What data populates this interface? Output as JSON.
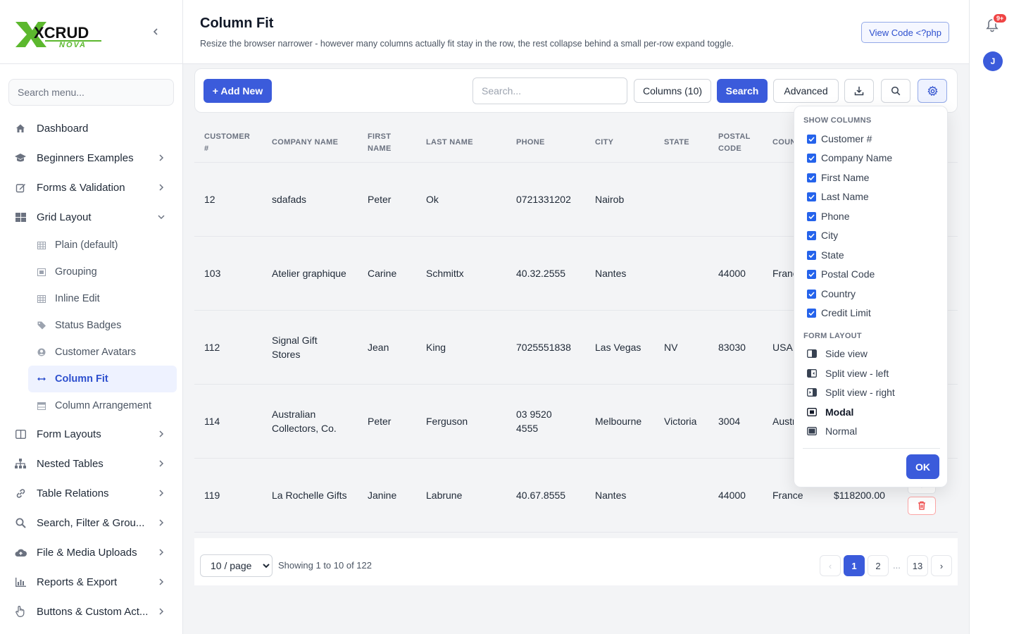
{
  "brand": {
    "logo_main": "XCRUD",
    "logo_sub": "NOVA"
  },
  "sidebar": {
    "search_placeholder": "Search menu...",
    "items": [
      {
        "label": "Dashboard"
      },
      {
        "label": "Beginners Examples"
      },
      {
        "label": "Forms & Validation"
      },
      {
        "label": "Grid Layout"
      },
      {
        "label": "Form Layouts"
      },
      {
        "label": "Nested Tables"
      },
      {
        "label": "Table Relations"
      },
      {
        "label": "Search, Filter & Grou..."
      },
      {
        "label": "File & Media Uploads"
      },
      {
        "label": "Reports & Export"
      },
      {
        "label": "Buttons & Custom Act..."
      }
    ],
    "sub_items": [
      {
        "label": "Plain (default)"
      },
      {
        "label": "Grouping"
      },
      {
        "label": "Inline Edit"
      },
      {
        "label": "Status Badges"
      },
      {
        "label": "Customer Avatars"
      },
      {
        "label": "Column Fit"
      },
      {
        "label": "Column Arrangement"
      }
    ]
  },
  "header": {
    "title": "Column Fit",
    "subtitle": "Resize the browser narrower - however many columns actually fit stay in the row, the rest collapse behind a small per-row expand toggle.",
    "view_code": "View Code <?php"
  },
  "rail": {
    "badge": "9+",
    "avatar": "J"
  },
  "toolbar": {
    "add_new": "+ Add New",
    "search_placeholder": "Search...",
    "columns": "Columns (10)",
    "search": "Search",
    "advanced": "Advanced"
  },
  "table": {
    "headers": [
      "CUSTOMER #",
      "COMPANY NAME",
      "FIRST NAME",
      "LAST NAME",
      "PHONE",
      "CITY",
      "STATE",
      "POSTAL CODE",
      "COUN"
    ],
    "rows": [
      {
        "c0": "12",
        "c1": "sdafads",
        "c2": "Peter",
        "c3": "Ok",
        "c4": "0721331202",
        "c5": "Nairob",
        "c6": "",
        "c7": "",
        "c8": "",
        "c9": ""
      },
      {
        "c0": "103",
        "c1": "Atelier graphique",
        "c2": "Carine",
        "c3": "Schmittx",
        "c4": "40.32.2555",
        "c5": "Nantes",
        "c6": "",
        "c7": "44000",
        "c8": "Franc",
        "c9": ""
      },
      {
        "c0": "112",
        "c1": "Signal Gift Stores",
        "c2": "Jean",
        "c3": "King",
        "c4": "7025551838",
        "c5": "Las Vegas",
        "c6": "NV",
        "c7": "83030",
        "c8": "USA",
        "c9": ""
      },
      {
        "c0": "114",
        "c1": "Australian Collectors, Co.",
        "c2": "Peter",
        "c3": "Ferguson",
        "c4": "03 9520 4555",
        "c5": "Melbourne",
        "c6": "Victoria",
        "c7": "3004",
        "c8": "Austr",
        "c9": ""
      },
      {
        "c0": "119",
        "c1": "La Rochelle Gifts",
        "c2": "Janine",
        "c3": "Labrune",
        "c4": "40.67.8555",
        "c5": "Nantes",
        "c6": "",
        "c7": "44000",
        "c8": "France",
        "c9": "$118200.00"
      }
    ]
  },
  "pager": {
    "per_page": "10 / page",
    "showing": "Showing 1 to 10 of 122",
    "prev": "‹",
    "p1": "1",
    "p2": "2",
    "dots": "...",
    "last": "13",
    "next": "›"
  },
  "column_panel": {
    "show_columns_title": "SHOW COLUMNS",
    "columns": [
      "Customer #",
      "Company Name",
      "First Name",
      "Last Name",
      "Phone",
      "City",
      "State",
      "Postal Code",
      "Country",
      "Credit Limit"
    ],
    "form_layout_title": "FORM LAYOUT",
    "layouts": [
      "Side view",
      "Split view - left",
      "Split view - right",
      "Modal",
      "Normal"
    ],
    "selected_layout": "Modal",
    "ok": "OK"
  },
  "colors": {
    "accent": "#3b5bdb",
    "danger": "#ef4444",
    "logo_green": "#5cb82e"
  }
}
